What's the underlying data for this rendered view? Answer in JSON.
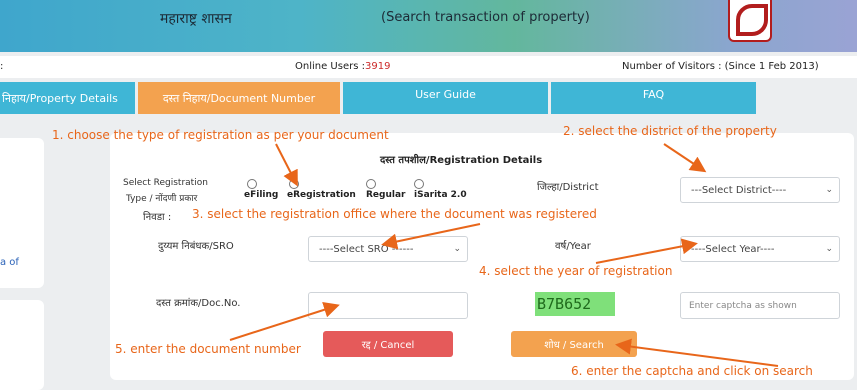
{
  "header": {
    "govt_name": "महाराष्ट्र शासन",
    "subtitle": "(Search transaction of property)"
  },
  "infobar": {
    "left": ":",
    "online_label": "Online Users :",
    "online_count": "3919",
    "visitors": "Number of Visitors : (Since 1 Feb 2013)"
  },
  "tabs": [
    {
      "label": "निहाय/Property Details"
    },
    {
      "label": "दस्त निहाय/Document Number"
    },
    {
      "label": "User Guide"
    },
    {
      "label": "FAQ"
    }
  ],
  "left_panel": {
    "partial_text": "a of"
  },
  "form": {
    "title": "दस्त तपशील/Registration Details",
    "reg_type_label_1": "Select Registration",
    "reg_type_label_2": "Type / नोंदणी प्रकार",
    "reg_options": [
      "eFiling",
      "eRegistration",
      "Regular",
      "iSarita 2.0"
    ],
    "office_label": "निवडा :",
    "district_label": "जिल्हा/District",
    "district_select": "---Select District----",
    "sro_label": "दुय्यम निबंधक/SRO",
    "sro_select": "----Select SRO ------",
    "year_label": "वर्ष/Year",
    "year_select": "----Select Year----",
    "doc_label": "दस्त क्रमांक/Doc.No.",
    "doc_value": "",
    "captcha_text": "B7B652",
    "captcha_placeholder": "Enter captcha as shown",
    "cancel_label": "रद्द / Cancel",
    "search_label": "शोध / Search"
  },
  "annotations": {
    "step1": "1. choose the type of registration as per your document",
    "step2": "2. select the district of the property",
    "step3": "3. select the registration office where the document was registered",
    "step4": "4. select the year of registration",
    "step5": "5. enter the document number",
    "step6": "6. enter the captcha and click on search"
  },
  "colors": {
    "tab_blue": "#3fb6d6",
    "tab_orange": "#f3a24f",
    "annotation": "#e8661a",
    "cancel": "#e55a5a",
    "search": "#f3a24f",
    "captcha_bg": "#7fe07a"
  }
}
